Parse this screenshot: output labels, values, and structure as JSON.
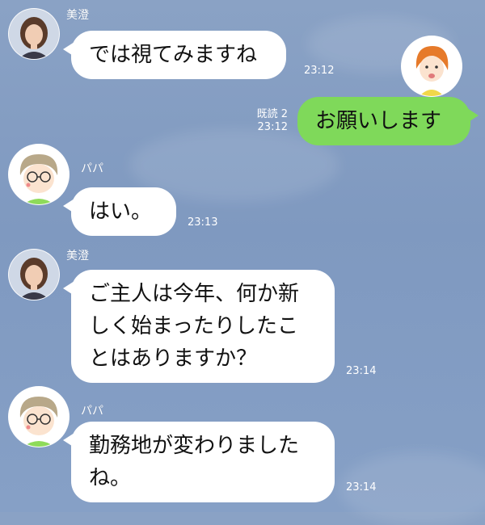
{
  "messages": [
    {
      "sender": "美澄",
      "text": [
        "では視てみますね"
      ],
      "time": "23:12"
    },
    {
      "sender": "me",
      "text": [
        "お願いします"
      ],
      "read": "既読 2",
      "time": "23:12"
    },
    {
      "sender": "パパ",
      "text": [
        "はい。"
      ],
      "time": "23:13"
    },
    {
      "sender": "美澄",
      "text": [
        "ご主人は今年、何か新",
        "しく始まったりしたこ",
        "とはありますか？"
      ],
      "time": "23:14"
    },
    {
      "sender": "パパ",
      "text": [
        "勤務地が変わりました",
        "ね。"
      ],
      "time": "23:14"
    }
  ],
  "colors": {
    "background": "#86a0c6",
    "incoming_bubble": "#ffffff",
    "outgoing_bubble": "#7fd95a"
  }
}
